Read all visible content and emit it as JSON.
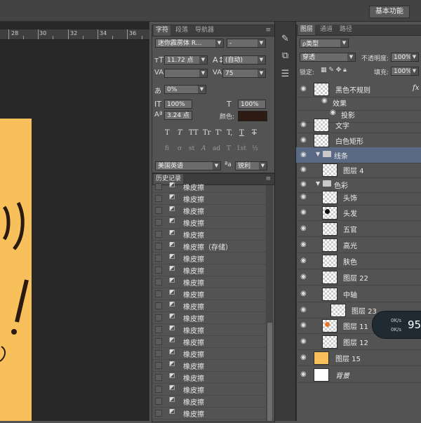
{
  "topbar": {
    "workspace": "基本功能"
  },
  "ruler": {
    "marks": [
      "28",
      "30",
      "32",
      "34",
      "36"
    ]
  },
  "char_panel": {
    "tabs": [
      "字符",
      "段落",
      "导航器"
    ],
    "font_family": "迷你霹雳体 R...",
    "font_style": "-",
    "size": "11.72 点",
    "leading": "(自动)",
    "kerning": "",
    "tracking": "75",
    "scale_ratio": "0%",
    "vscale": "100%",
    "hscale": "100%",
    "baseline": "3.24 点",
    "color_label": "颜色:",
    "language": "美国英语",
    "aa_label": "a",
    "antialias": "锐利",
    "style_buttons": [
      "T",
      "T",
      "TT",
      "Tr",
      "T'",
      "T,",
      "T",
      "T"
    ],
    "ot_buttons": [
      "fi",
      "σ",
      "st",
      "A",
      "ad",
      "T",
      "1st",
      "½"
    ]
  },
  "history": {
    "title": "历史记录",
    "items": [
      "橡皮擦",
      "橡皮擦",
      "橡皮擦",
      "橡皮擦",
      "橡皮擦",
      "橡皮擦（存储）",
      "橡皮擦",
      "橡皮擦",
      "橡皮擦",
      "橡皮擦",
      "橡皮擦",
      "橡皮擦",
      "橡皮擦",
      "橡皮擦",
      "橡皮擦",
      "橡皮擦",
      "橡皮擦",
      "橡皮擦",
      "橡皮擦",
      "橡皮擦"
    ]
  },
  "layers": {
    "tabs": [
      "图层",
      "通道",
      "路径"
    ],
    "filter": "类型",
    "blend_mode": "穿透",
    "opacity_label": "不透明度:",
    "opacity": "100%",
    "lock_label": "锁定:",
    "fill_label": "填充:",
    "fill": "100%",
    "rows": [
      {
        "name": "黑色不规则",
        "fx": "fx"
      },
      {
        "name": "效果"
      },
      {
        "name": "投影"
      },
      {
        "name": "文字"
      },
      {
        "name": "白色矩形"
      },
      {
        "name": "线条"
      },
      {
        "name": "图层 4"
      },
      {
        "name": "色彩"
      },
      {
        "name": "头饰"
      },
      {
        "name": "头发"
      },
      {
        "name": "五官"
      },
      {
        "name": "高光"
      },
      {
        "name": "肤色"
      },
      {
        "name": "图层 22"
      },
      {
        "name": "中轴"
      },
      {
        "name": "图层 23"
      },
      {
        "name": "图层 11"
      },
      {
        "name": "图层 12"
      },
      {
        "name": "图层 15"
      },
      {
        "name": "背景"
      }
    ]
  },
  "net_widget": {
    "up": "0K/s",
    "down": "0K/s",
    "score": "95"
  }
}
